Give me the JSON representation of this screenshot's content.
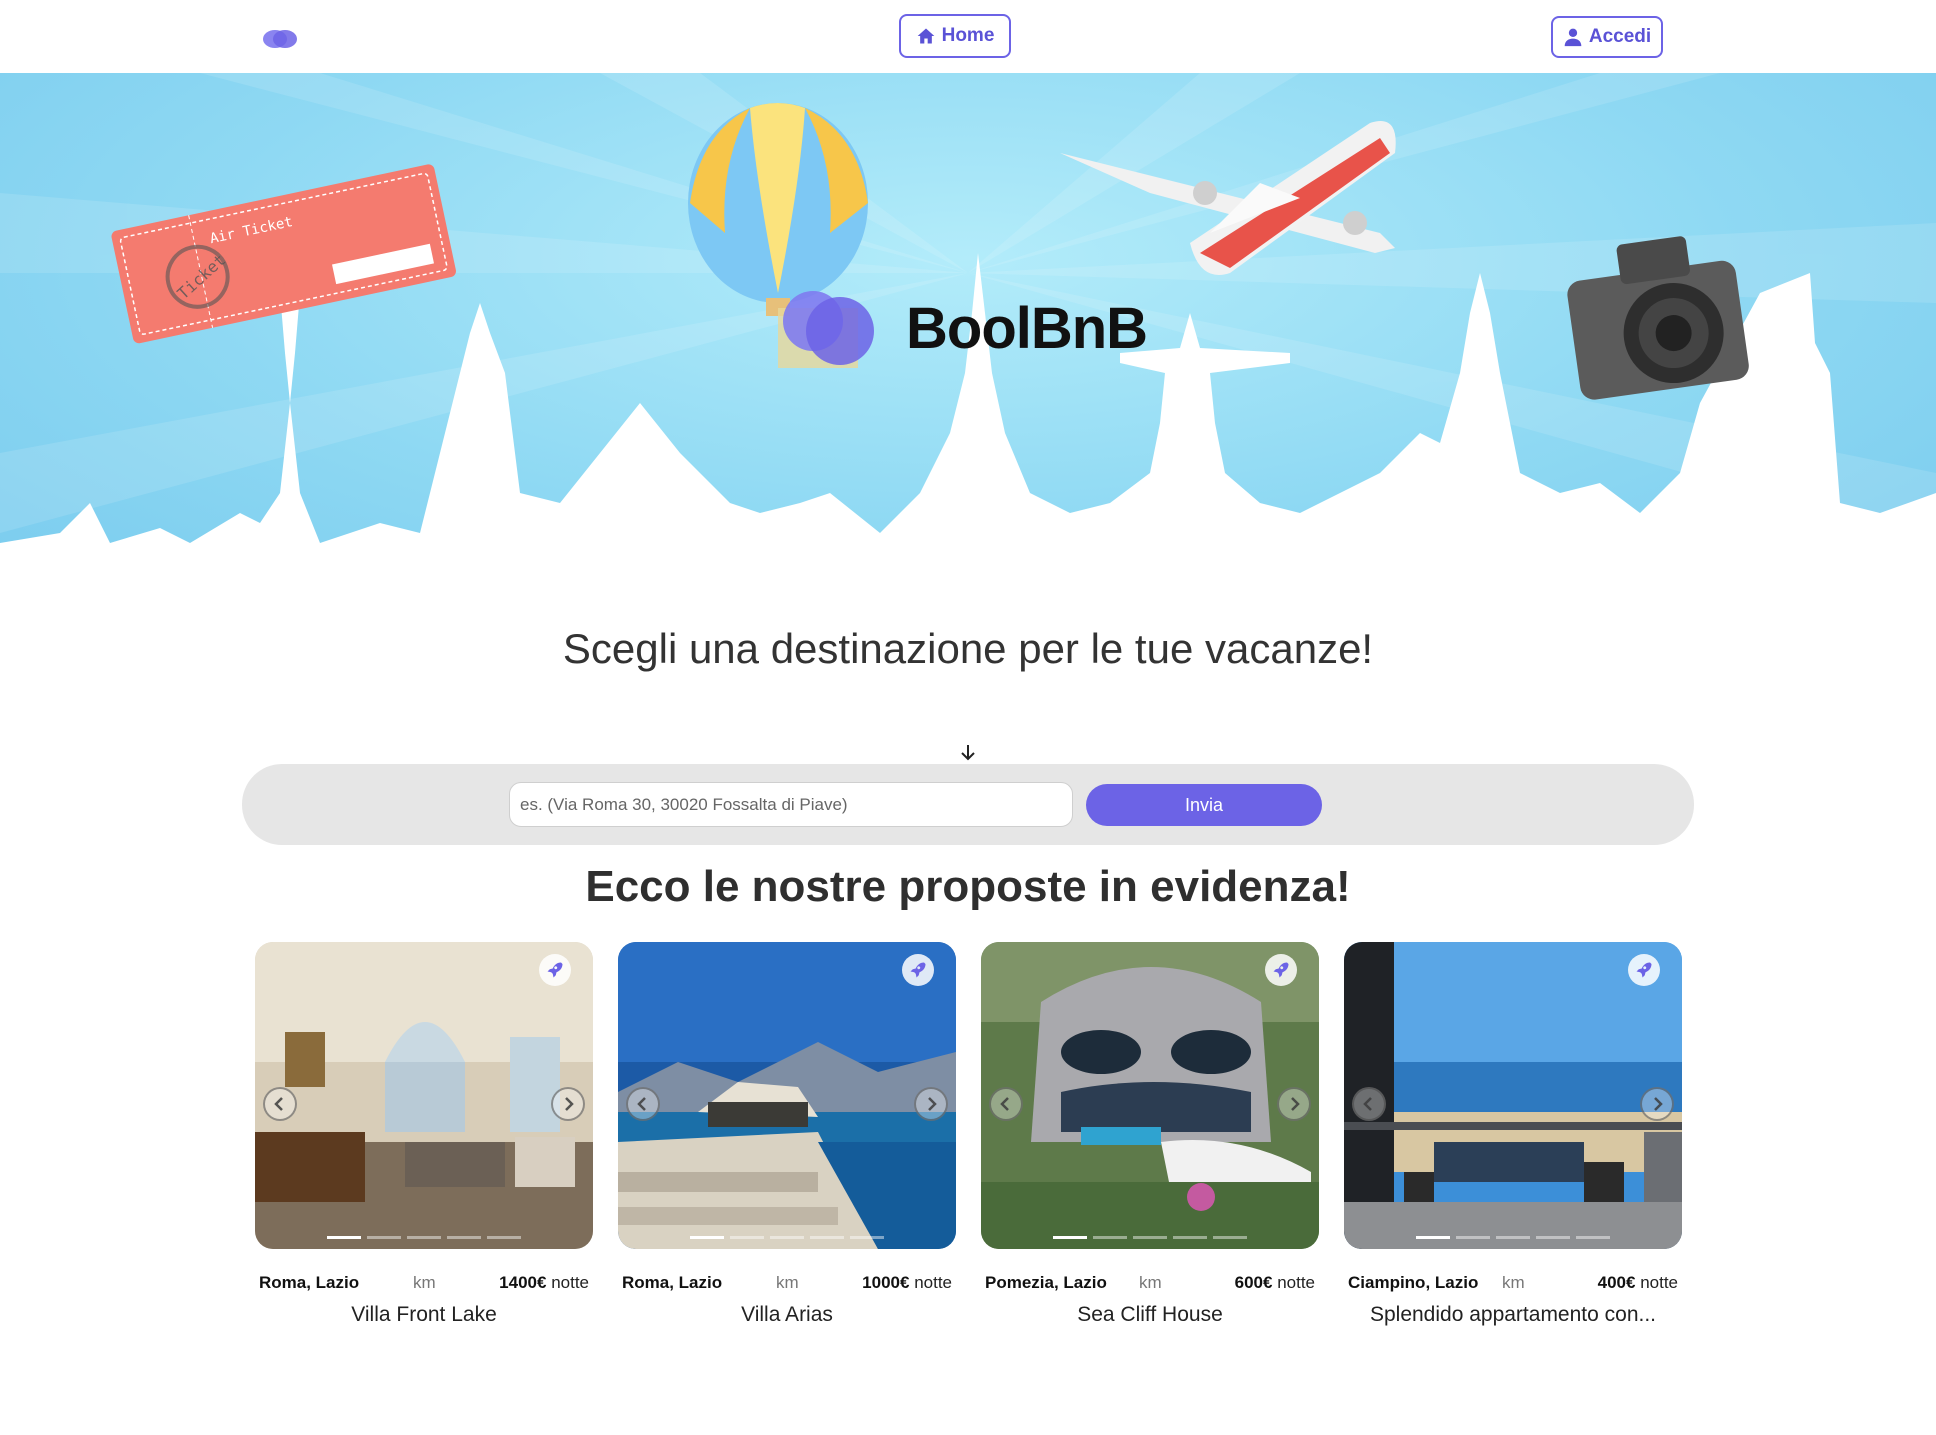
{
  "navbar": {
    "logo_icon": "heart-logo-icon",
    "home_label": "Home",
    "login_label": "Accedi",
    "accent_color": "#6c63e6"
  },
  "hero": {
    "brand_name": "BoolBnB",
    "ticket_title": "Air Ticket",
    "ticket_stamp": "Ticket"
  },
  "search": {
    "headline": "Scegli una destinazione per le tue vacanze!",
    "placeholder": "es. (Via Roma 30, 30020 Fossalta di Piave)",
    "submit_label": "Invia"
  },
  "featured": {
    "title": "Ecco le nostre proposte in evidenza!",
    "km_label": "km",
    "night_label": "notte",
    "cards": [
      {
        "location": "Roma, Lazio",
        "price": "1400€",
        "title": "Villa Front Lake"
      },
      {
        "location": "Roma, Lazio",
        "price": "1000€",
        "title": "Villa Arias"
      },
      {
        "location": "Pomezia, Lazio",
        "price": "600€",
        "title": "Sea Cliff House"
      },
      {
        "location": "Ciampino, Lazio",
        "price": "400€",
        "title": "Splendido appartamento con..."
      }
    ]
  }
}
